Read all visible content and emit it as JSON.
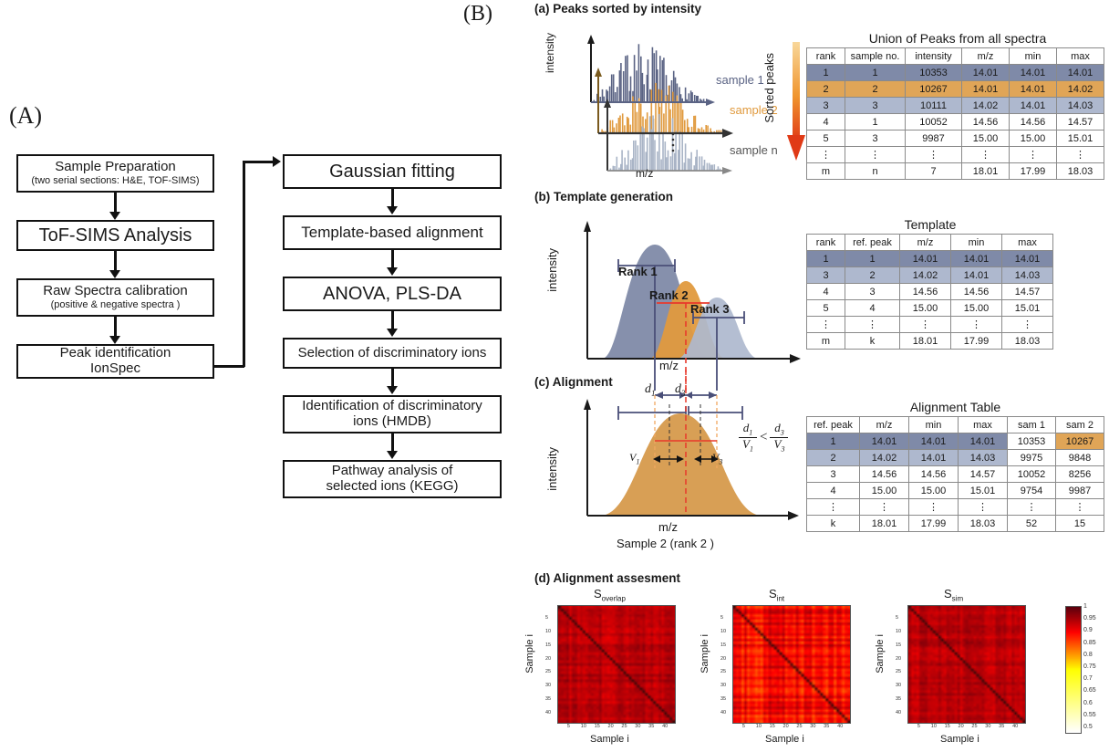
{
  "figure": {
    "panel_a_label": "(A)",
    "panel_b_label": "(B)"
  },
  "flowchart": {
    "left_column": [
      {
        "line1": "Sample Preparation",
        "line2": "(two serial sections: H&E, TOF-SIMS)"
      },
      {
        "line1": "ToF-SIMS Analysis",
        "line2": ""
      },
      {
        "line1": "Raw Spectra calibration",
        "line2": "(positive & negative spectra )"
      },
      {
        "line1": "Peak identification",
        "line2": "IonSpec"
      }
    ],
    "right_column": [
      {
        "line1": "Gaussian fitting",
        "line2": ""
      },
      {
        "line1": "Template-based alignment",
        "line2": ""
      },
      {
        "line1": "ANOVA, PLS-DA",
        "line2": ""
      },
      {
        "line1": "Selection of  discriminatory ions",
        "line2": ""
      },
      {
        "line1": "Identification of discriminatory",
        "line2": "ions (HMDB)"
      },
      {
        "line1": "Pathway analysis of",
        "line2": "selected ions (KEGG)"
      }
    ]
  },
  "panel_a_sub": {
    "title": "(a) Peaks sorted by intensity",
    "y_axis": "intensity",
    "x_axis": "m/z",
    "sample_labels": [
      "sample 1",
      "sample 2",
      "sample n"
    ],
    "arrow_label": "Sorted peaks",
    "colors": {
      "sample1": "#5a6384",
      "sample2": "#e09a3e",
      "samplen": "#a9b4c6",
      "arrow_top": "#f6d08a",
      "arrow_bottom": "#e03a16"
    },
    "table": {
      "caption": "Union of Peaks from all spectra",
      "headers": [
        "rank",
        "sample no.",
        "intensity",
        "m/z",
        "min",
        "max"
      ],
      "rows": [
        {
          "cells": [
            "1",
            "1",
            "10353",
            "14.01",
            "14.01",
            "14.01"
          ],
          "style": "dark"
        },
        {
          "cells": [
            "2",
            "2",
            "10267",
            "14.01",
            "14.01",
            "14.02"
          ],
          "style": "orange"
        },
        {
          "cells": [
            "3",
            "3",
            "10111",
            "14.02",
            "14.01",
            "14.03"
          ],
          "style": "light"
        },
        {
          "cells": [
            "4",
            "1",
            "10052",
            "14.56",
            "14.56",
            "14.57"
          ],
          "style": "plain"
        },
        {
          "cells": [
            "5",
            "3",
            "9987",
            "15.00",
            "15.00",
            "15.01"
          ],
          "style": "plain"
        },
        {
          "cells": [
            "⋮",
            "⋮",
            "⋮",
            "⋮",
            "⋮",
            "⋮"
          ],
          "style": "plain"
        },
        {
          "cells": [
            "m",
            "n",
            "7",
            "18.01",
            "17.99",
            "18.03"
          ],
          "style": "plain"
        }
      ]
    }
  },
  "panel_b_sub": {
    "title": "(b) Template generation",
    "y_axis": "intensity",
    "x_axis": "m/z",
    "rank_labels": [
      "Rank 1",
      "Rank 2",
      "Rank 3"
    ],
    "table": {
      "caption": "Template",
      "headers": [
        "rank",
        "ref. peak",
        "m/z",
        "min",
        "max"
      ],
      "rows": [
        {
          "cells": [
            "1",
            "1",
            "14.01",
            "14.01",
            "14.01"
          ],
          "style": "dark"
        },
        {
          "cells": [
            "3",
            "2",
            "14.02",
            "14.01",
            "14.03"
          ],
          "style": "light"
        },
        {
          "cells": [
            "4",
            "3",
            "14.56",
            "14.56",
            "14.57"
          ],
          "style": "plain"
        },
        {
          "cells": [
            "5",
            "4",
            "15.00",
            "15.00",
            "15.01"
          ],
          "style": "plain"
        },
        {
          "cells": [
            "⋮",
            "⋮",
            "⋮",
            "⋮",
            "⋮"
          ],
          "style": "plain"
        },
        {
          "cells": [
            "m",
            "k",
            "18.01",
            "17.99",
            "18.03"
          ],
          "style": "plain"
        }
      ]
    }
  },
  "panel_c_sub": {
    "title": "(c) Alignment",
    "y_axis": "intensity",
    "x_axis": "m/z",
    "sample_caption": "Sample 2  (rank 2 )",
    "d1": "d",
    "d1_sub": "1",
    "d3": "d",
    "d3_sub": "3",
    "v1": "V",
    "v1_sub": "1",
    "v3": "V",
    "v3_sub": "3",
    "inequality": "<",
    "table": {
      "caption": "Alignment Table",
      "headers": [
        "ref. peak",
        "m/z",
        "min",
        "max",
        "sam 1",
        "sam 2"
      ],
      "rows": [
        {
          "cells": [
            "1",
            "14.01",
            "14.01",
            "14.01",
            "10353",
            "10267"
          ],
          "cellstyles": [
            "dark",
            "dark",
            "dark",
            "dark",
            "plain",
            "orange"
          ]
        },
        {
          "cells": [
            "2",
            "14.02",
            "14.01",
            "14.03",
            "9975",
            "9848"
          ],
          "cellstyles": [
            "light",
            "light",
            "light",
            "light",
            "plain",
            "plain"
          ]
        },
        {
          "cells": [
            "3",
            "14.56",
            "14.56",
            "14.57",
            "10052",
            "8256"
          ],
          "cellstyles": [
            "plain",
            "plain",
            "plain",
            "plain",
            "plain",
            "plain"
          ]
        },
        {
          "cells": [
            "4",
            "15.00",
            "15.00",
            "15.01",
            "9754",
            "9987"
          ],
          "cellstyles": [
            "plain",
            "plain",
            "plain",
            "plain",
            "plain",
            "plain"
          ]
        },
        {
          "cells": [
            "⋮",
            "⋮",
            "⋮",
            "⋮",
            "⋮",
            "⋮"
          ],
          "cellstyles": [
            "plain",
            "plain",
            "plain",
            "plain",
            "plain",
            "plain"
          ]
        },
        {
          "cells": [
            "k",
            "18.01",
            "17.99",
            "18.03",
            "52",
            "15"
          ],
          "cellstyles": [
            "plain",
            "plain",
            "plain",
            "plain",
            "plain",
            "plain"
          ]
        }
      ]
    }
  },
  "panel_d_sub": {
    "title": "(d) Alignment assesment",
    "heatmaps": [
      {
        "title_main": "S",
        "title_sub": "overlap",
        "x_label": "Sample i",
        "y_label": "Sample i"
      },
      {
        "title_main": "S",
        "title_sub": "int",
        "x_label": "Sample i",
        "y_label": "Sample i"
      },
      {
        "title_main": "S",
        "title_sub": "sim",
        "x_label": "Sample i",
        "y_label": "Sample i"
      }
    ],
    "axis_ticks": [
      "5",
      "10",
      "15",
      "20",
      "25",
      "30",
      "35",
      "40"
    ],
    "colorbar": {
      "ticks": [
        "1",
        "0.95",
        "0.9",
        "0.85",
        "0.8",
        "0.75",
        "0.7",
        "0.65",
        "0.6",
        "0.55",
        "0.5"
      ],
      "min": 0.5,
      "max": 1.0,
      "low_color": "#ffffff",
      "mid_color": "#ffff00",
      "high_color": "#5c0d0d"
    }
  },
  "chart_data": {
    "type": "heatmap",
    "title": "(d) Alignment assesment",
    "panels": [
      {
        "name": "S_overlap",
        "xlabel": "Sample i",
        "ylabel": "Sample i",
        "xlim": [
          1,
          43
        ],
        "ylim": [
          1,
          43
        ],
        "value_range": [
          0.85,
          1.0
        ]
      },
      {
        "name": "S_int",
        "xlabel": "Sample i",
        "ylabel": "Sample i",
        "xlim": [
          1,
          43
        ],
        "ylim": [
          1,
          43
        ],
        "value_range": [
          0.8,
          1.0
        ]
      },
      {
        "name": "S_sim",
        "xlabel": "Sample i",
        "ylabel": "Sample i",
        "xlim": [
          1,
          43
        ],
        "ylim": [
          1,
          43
        ],
        "value_range": [
          0.85,
          1.0
        ]
      }
    ],
    "colorbar_range": [
      0.5,
      1.0
    ],
    "colorbar_ticks": [
      0.5,
      0.55,
      0.6,
      0.65,
      0.7,
      0.75,
      0.8,
      0.85,
      0.9,
      0.95,
      1.0
    ]
  }
}
